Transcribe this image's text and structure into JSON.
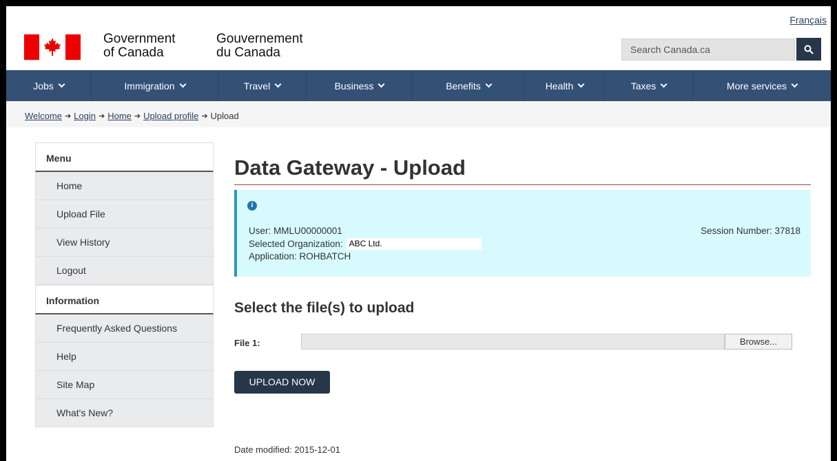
{
  "header": {
    "language_link": "Français",
    "signature_en": [
      "Government",
      "of Canada"
    ],
    "signature_fr": [
      "Gouvernement",
      "du Canada"
    ],
    "search_placeholder": "Search Canada.ca",
    "search_icon": "search-icon"
  },
  "nav": {
    "items": [
      {
        "label": "Jobs"
      },
      {
        "label": "Immigration"
      },
      {
        "label": "Travel"
      },
      {
        "label": "Business"
      },
      {
        "label": "Benefits"
      },
      {
        "label": "Health"
      },
      {
        "label": "Taxes"
      },
      {
        "label": "More services"
      }
    ]
  },
  "breadcrumb": {
    "items": [
      "Welcome",
      "Login",
      "Home",
      "Upload profile"
    ],
    "current": "Upload"
  },
  "sidebar": {
    "menu_heading": "Menu",
    "menu_items": [
      "Home",
      "Upload File",
      "View History",
      "Logout"
    ],
    "info_heading": "Information",
    "info_items": [
      "Frequently Asked Questions",
      "Help",
      "Site Map",
      "What's New?"
    ]
  },
  "main": {
    "title": "Data Gateway - Upload",
    "info": {
      "user": "User: MMLU00000001",
      "org_label": "Selected Organization:",
      "org_value": "ABC Ltd.",
      "application": "Application: ROHBATCH",
      "session": "Session Number: 37818"
    },
    "upload_heading": "Select the file(s) to upload",
    "file_label": "File 1:",
    "browse_label": "Browse...",
    "upload_button": "UPLOAD NOW",
    "date_modified": "Date modified: 2015-12-01"
  },
  "colors": {
    "nav_bg": "#335075",
    "button_bg": "#26374a",
    "flag_red": "#ee0000",
    "info_bg": "#d7faff",
    "title_rule": "#af3c43"
  }
}
